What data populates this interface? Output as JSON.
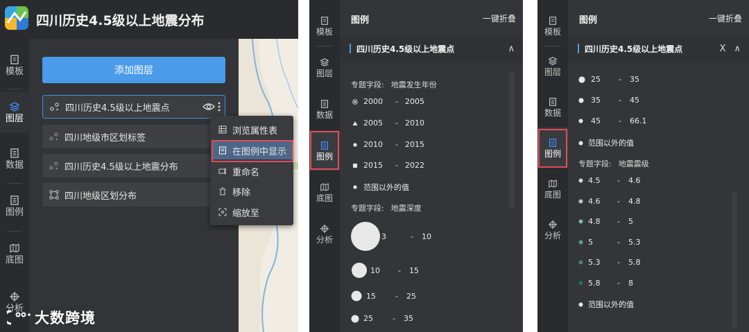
{
  "panel1": {
    "title": "四川历史4.5级以上地震分布",
    "nav": [
      {
        "label": "模板",
        "icon": "template-icon"
      },
      {
        "label": "图层",
        "icon": "layers-icon",
        "active": true
      },
      {
        "label": "数据",
        "icon": "data-icon"
      },
      {
        "label": "图例",
        "icon": "legend-icon"
      },
      {
        "label": "底图",
        "icon": "basemap-icon"
      },
      {
        "label": "分析",
        "icon": "analysis-icon"
      }
    ],
    "add_layer_label": "添加图层",
    "layers": [
      {
        "name": "四川历史4.5级以上地震点",
        "icon": "point-layer-icon",
        "selected": true
      },
      {
        "name": "四川地级市区划标签",
        "icon": "label-layer-icon"
      },
      {
        "name": "四川历史4.5级以上地震分布",
        "icon": "point-layer-icon"
      },
      {
        "name": "四川地级区划分布",
        "icon": "polygon-layer-icon"
      }
    ],
    "context_menu": [
      {
        "label": "浏览属性表",
        "icon": "table-icon"
      },
      {
        "label": "在图例中显示",
        "icon": "legend-show-icon",
        "active": true
      },
      {
        "label": "重命名",
        "icon": "rename-icon"
      },
      {
        "label": "移除",
        "icon": "trash-icon"
      },
      {
        "label": "缩放至",
        "icon": "zoom-to-icon"
      }
    ]
  },
  "panel2": {
    "nav": [
      {
        "label": "模板"
      },
      {
        "label": "图层"
      },
      {
        "label": "数据"
      },
      {
        "label": "图例",
        "active": true
      },
      {
        "label": "底图"
      },
      {
        "label": "分析"
      }
    ],
    "legend_title": "图例",
    "collapse_all": "一键折叠",
    "layer_name": "四川历史4.5级以上地震点",
    "collapse_symbol": "∧",
    "field_label": "专题字段:",
    "field1": "地震发生年份",
    "year_rows": [
      {
        "symbol": "circle-dot",
        "lo": "2000",
        "hi": "2005"
      },
      {
        "symbol": "triangle",
        "lo": "2005",
        "hi": "2010"
      },
      {
        "symbol": "dot",
        "lo": "2010",
        "hi": "2015"
      },
      {
        "symbol": "square",
        "lo": "2015",
        "hi": "2022"
      }
    ],
    "out_of_range": "范围以外的值",
    "field2": "地震深度",
    "depth_rows": [
      {
        "lo": "3",
        "hi": "10"
      },
      {
        "lo": "10",
        "hi": "15"
      },
      {
        "lo": "15",
        "hi": "25"
      },
      {
        "lo": "25",
        "hi": "35"
      }
    ]
  },
  "panel3": {
    "legend_title": "图例",
    "collapse_all": "一键折叠",
    "layer_name": "四川历史4.5级以上地震点",
    "close_symbol": "X",
    "collapse_symbol": "∧",
    "depth_rows": [
      {
        "lo": "25",
        "hi": "35"
      },
      {
        "lo": "35",
        "hi": "45"
      },
      {
        "lo": "45",
        "hi": "66.1"
      }
    ],
    "out_of_range": "范围以外的值",
    "field_label": "专题字段:",
    "field": "地震震级",
    "mag_rows": [
      {
        "lo": "4.5",
        "hi": "4.6",
        "color": "#c8ded6"
      },
      {
        "lo": "4.6",
        "hi": "4.8",
        "color": "#a9cfc2"
      },
      {
        "lo": "4.8",
        "hi": "5",
        "color": "#7fb9a5"
      },
      {
        "lo": "5",
        "hi": "5.3",
        "color": "#57a08a"
      },
      {
        "lo": "5.3",
        "hi": "5.8",
        "color": "#3b8873"
      },
      {
        "lo": "5.8",
        "hi": "8",
        "color": "#2a6b5b"
      }
    ],
    "out_of_range2": "范围以外的值"
  },
  "watermark": "大数跨境"
}
